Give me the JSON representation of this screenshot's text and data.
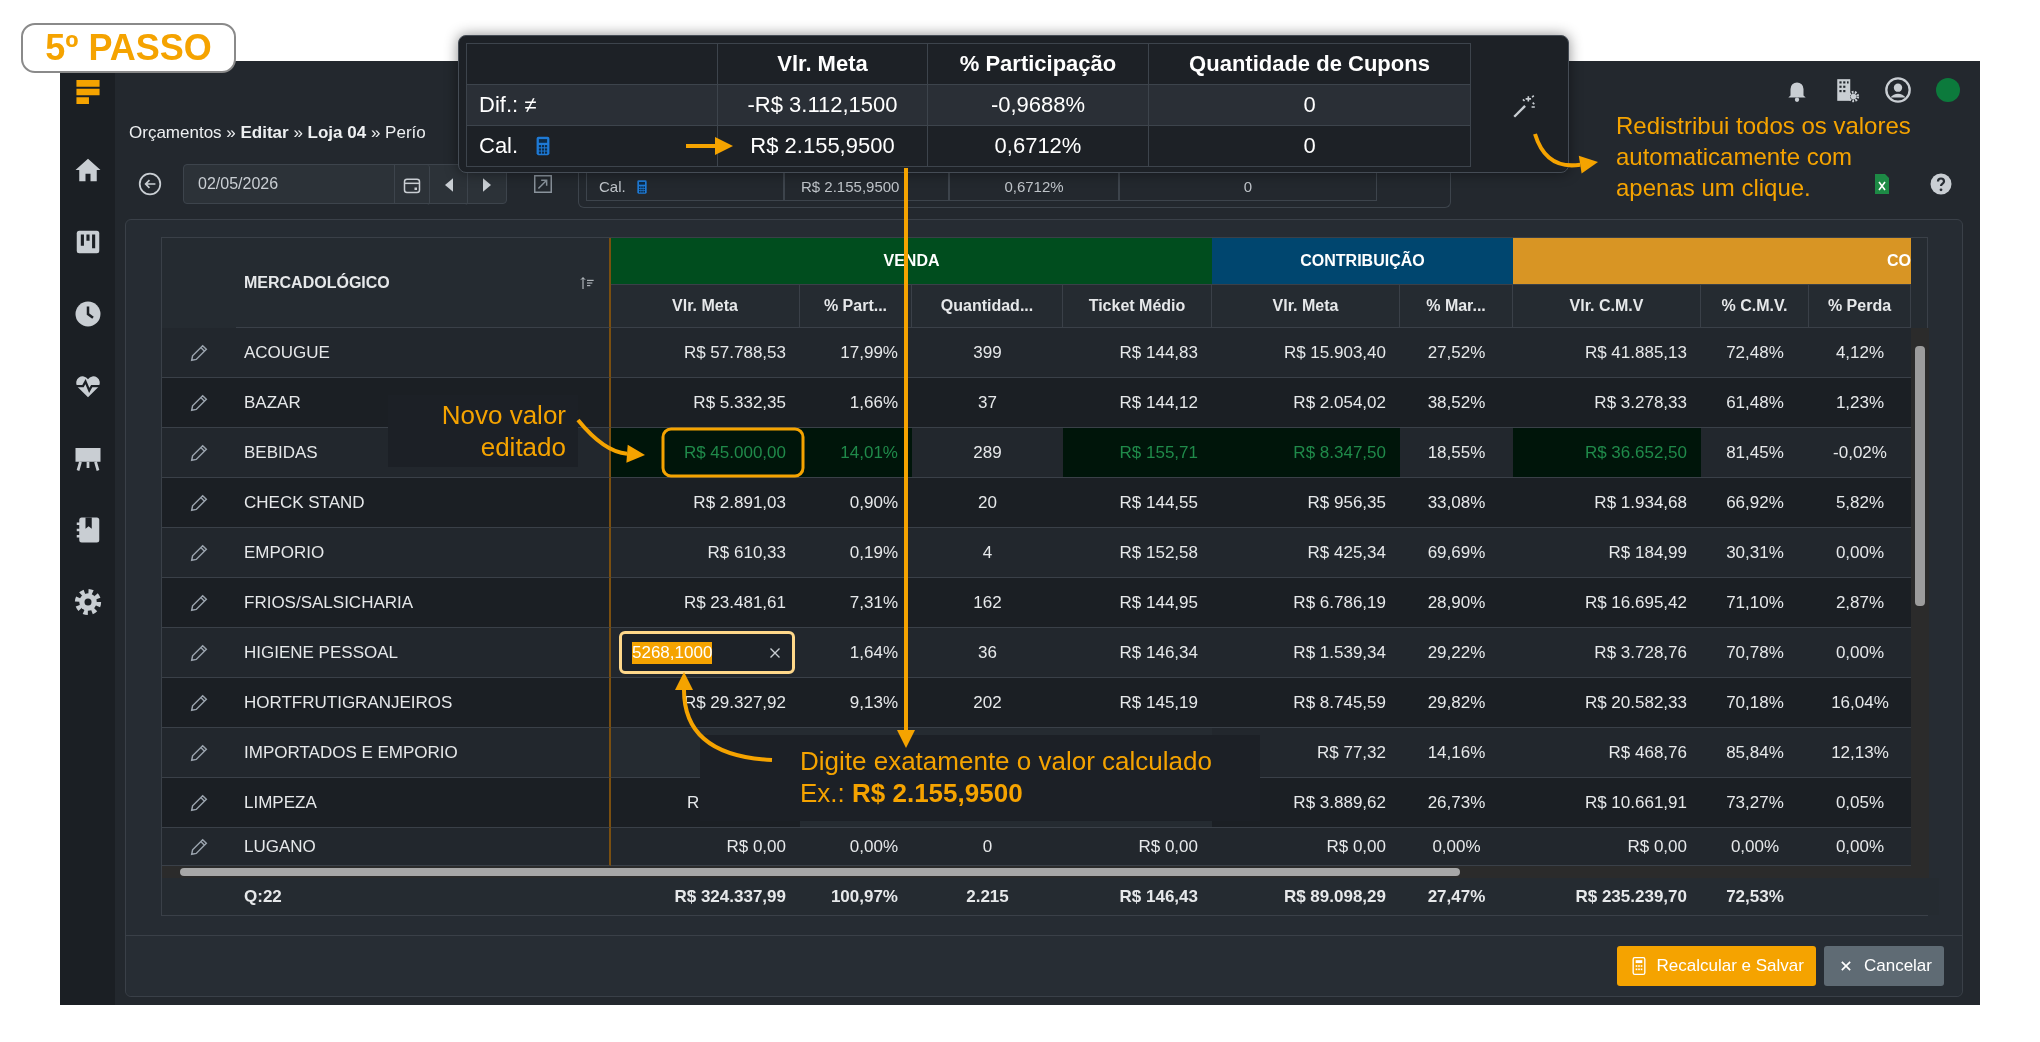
{
  "step_badge": "5º PASSO",
  "breadcrumb": "Orçamentos » **Editar** » **Loja 04** » Perío",
  "toolbar": {
    "date": "02/05/2026"
  },
  "summary_card": {
    "label": "Cal.",
    "values": [
      "R$ 2.155,9500",
      "0,6712%",
      "0"
    ]
  },
  "popup": {
    "columns": [
      "Vlr. Meta",
      "% Participação",
      "Quantidade de Cupons"
    ],
    "rows": [
      {
        "kind": "difference",
        "label": "Dif.: ≠",
        "values": [
          "-R$ 3.112,1500",
          "-0,9688%",
          "0"
        ]
      },
      {
        "kind": "calculated",
        "label": "Cal.",
        "values": [
          "R$ 2.155,9500",
          "0,6712%",
          "0"
        ]
      }
    ]
  },
  "tips": [
    {
      "kind": "wand",
      "text": "Redistribui todos os valores\nautomaticamente com\napenas um clique."
    },
    {
      "kind": "edited",
      "text": "Novo valor\neditado"
    },
    {
      "kind": "type",
      "text": "Digite exatamente o valor calculado\nEx.: **R$ 2.155,9500**"
    }
  ],
  "grid": {
    "row_header": "MERCADOLÓGICO",
    "groups": [
      {
        "label": "VENDA",
        "color": "#004d1e",
        "columns": [
          "Vlr. Meta",
          "% Part...",
          "Quantidad...",
          "Ticket Médio"
        ]
      },
      {
        "label": "CONTRIBUIÇÃO",
        "color": "#00466f",
        "columns": [
          "Vlr. Meta",
          "% Mar..."
        ]
      },
      {
        "label": "CO",
        "color": "#d89524",
        "columns": [
          "Vlr. C.M.V",
          "% C.M.V.",
          "% Perda"
        ]
      }
    ],
    "rows": [
      {
        "name": "ACOUGUE",
        "cells": [
          {
            "value": "R$ 57.788,53",
            "changed": false
          },
          {
            "value": "17,99%",
            "changed": false
          },
          {
            "value": "399",
            "changed": false
          },
          {
            "value": "R$ 144,83",
            "changed": false
          },
          {
            "value": "R$ 15.903,40",
            "changed": false
          },
          {
            "value": "27,52%",
            "changed": false
          },
          {
            "value": "R$ 41.885,13",
            "changed": false
          },
          {
            "value": "72,48%",
            "changed": false
          },
          {
            "value": "4,12%",
            "changed": false
          }
        ]
      },
      {
        "name": "BAZAR",
        "cells": [
          {
            "value": "R$ 5.332,35",
            "changed": false
          },
          {
            "value": "1,66%",
            "changed": false
          },
          {
            "value": "37",
            "changed": false
          },
          {
            "value": "R$ 144,12",
            "changed": false
          },
          {
            "value": "R$ 2.054,02",
            "changed": false
          },
          {
            "value": "38,52%",
            "changed": false
          },
          {
            "value": "R$ 3.278,33",
            "changed": false
          },
          {
            "value": "61,48%",
            "changed": false
          },
          {
            "value": "1,23%",
            "changed": false
          }
        ]
      },
      {
        "name": "BEBIDAS",
        "cells": [
          {
            "value": "R$ 45.000,00",
            "changed": true
          },
          {
            "value": "14,01%",
            "changed": true
          },
          {
            "value": "289",
            "changed": false
          },
          {
            "value": "R$ 155,71",
            "changed": true
          },
          {
            "value": "R$ 8.347,50",
            "changed": true
          },
          {
            "value": "18,55%",
            "changed": false
          },
          {
            "value": "R$ 36.652,50",
            "changed": true
          },
          {
            "value": "81,45%",
            "changed": false
          },
          {
            "value": "-0,02%",
            "changed": false
          }
        ]
      },
      {
        "name": "CHECK STAND",
        "cells": [
          {
            "value": "R$ 2.891,03",
            "changed": false
          },
          {
            "value": "0,90%",
            "changed": false
          },
          {
            "value": "20",
            "changed": false
          },
          {
            "value": "R$ 144,55",
            "changed": false
          },
          {
            "value": "R$ 956,35",
            "changed": false
          },
          {
            "value": "33,08%",
            "changed": false
          },
          {
            "value": "R$ 1.934,68",
            "changed": false
          },
          {
            "value": "66,92%",
            "changed": false
          },
          {
            "value": "5,82%",
            "changed": false
          }
        ]
      },
      {
        "name": "EMPORIO",
        "cells": [
          {
            "value": "R$ 610,33",
            "changed": false
          },
          {
            "value": "0,19%",
            "changed": false
          },
          {
            "value": "4",
            "changed": false
          },
          {
            "value": "R$ 152,58",
            "changed": false
          },
          {
            "value": "R$ 425,34",
            "changed": false
          },
          {
            "value": "69,69%",
            "changed": false
          },
          {
            "value": "R$ 184,99",
            "changed": false
          },
          {
            "value": "30,31%",
            "changed": false
          },
          {
            "value": "0,00%",
            "changed": false
          }
        ]
      },
      {
        "name": "FRIOS/SALSICHARIA",
        "cells": [
          {
            "value": "R$ 23.481,61",
            "changed": false
          },
          {
            "value": "7,31%",
            "changed": false
          },
          {
            "value": "162",
            "changed": false
          },
          {
            "value": "R$ 144,95",
            "changed": false
          },
          {
            "value": "R$ 6.786,19",
            "changed": false
          },
          {
            "value": "28,90%",
            "changed": false
          },
          {
            "value": "R$ 16.695,42",
            "changed": false
          },
          {
            "value": "71,10%",
            "changed": false
          },
          {
            "value": "2,87%",
            "changed": false
          }
        ]
      },
      {
        "name": "HIGIENE PESSOAL",
        "input": {
          "value": "5268,1000",
          "selected": true
        },
        "cells": [
          {},
          {
            "value": "1,64%",
            "changed": false
          },
          {
            "value": "36",
            "changed": false
          },
          {
            "value": "R$ 146,34",
            "changed": false
          },
          {
            "value": "R$ 1.539,34",
            "changed": false
          },
          {
            "value": "29,22%",
            "changed": false
          },
          {
            "value": "R$ 3.728,76",
            "changed": false
          },
          {
            "value": "70,78%",
            "changed": false
          },
          {
            "value": "0,00%",
            "changed": false
          }
        ]
      },
      {
        "name": "HORTFRUTIGRANJEIROS",
        "cells": [
          {
            "value": "R$ 29.327,92",
            "changed": false
          },
          {
            "value": "9,13%",
            "changed": false
          },
          {
            "value": "202",
            "changed": false
          },
          {
            "value": "R$ 145,19",
            "changed": false
          },
          {
            "value": "R$ 8.745,59",
            "changed": false
          },
          {
            "value": "29,82%",
            "changed": false
          },
          {
            "value": "R$ 20.582,33",
            "changed": false
          },
          {
            "value": "70,18%",
            "changed": false
          },
          {
            "value": "16,04%",
            "changed": false
          }
        ]
      },
      {
        "name": "IMPORTADOS E EMPORIO",
        "cells": [
          {},
          {},
          {},
          {},
          {
            "value": "R$ 77,32",
            "changed": false
          },
          {
            "value": "14,16%",
            "changed": false
          },
          {
            "value": "R$ 468,76",
            "changed": false
          },
          {
            "value": "85,84%",
            "changed": false
          },
          {
            "value": "12,13%",
            "changed": false
          }
        ]
      },
      {
        "name": "LIMPEZA",
        "cells": [
          {
            "value": "R",
            "changed": false
          },
          {},
          {},
          {},
          {
            "value": "R$ 3.889,62",
            "changed": false
          },
          {
            "value": "26,73%",
            "changed": false
          },
          {
            "value": "R$ 10.661,91",
            "changed": false
          },
          {
            "value": "73,27%",
            "changed": false
          },
          {
            "value": "0,05%",
            "changed": false
          }
        ]
      },
      {
        "name": "LUGANO",
        "cells": [
          {
            "value": "R$ 0,00",
            "changed": false
          },
          {
            "value": "0,00%",
            "changed": false
          },
          {
            "value": "0",
            "changed": false
          },
          {
            "value": "R$ 0,00",
            "changed": false
          },
          {
            "value": "R$ 0,00",
            "changed": false
          },
          {
            "value": "0,00%",
            "changed": false
          },
          {
            "value": "R$ 0,00",
            "changed": false
          },
          {
            "value": "0,00%",
            "changed": false
          },
          {
            "value": "0,00%",
            "changed": false
          }
        ]
      }
    ],
    "totals": {
      "label": "Q:22",
      "values": [
        "R$ 324.337,99",
        "100,97%",
        "2.215",
        "R$ 146,43",
        "R$ 89.098,29",
        "27,47%",
        "R$ 235.239,70",
        "72,53%"
      ]
    }
  },
  "buttons": [
    {
      "kind": "primary",
      "label": "Recalcular e Salvar"
    },
    {
      "kind": "secondary",
      "label": "Cancelar"
    }
  ]
}
